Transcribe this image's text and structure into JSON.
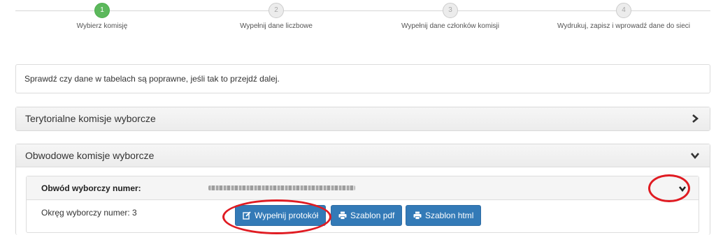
{
  "stepper": {
    "steps": [
      {
        "number": "1",
        "label": "Wybierz komisję",
        "active": true
      },
      {
        "number": "2",
        "label": "Wypełnij dane liczbowe",
        "active": false
      },
      {
        "number": "3",
        "label": "Wypełnij dane członków komisji",
        "active": false
      },
      {
        "number": "4",
        "label": "Wydrukuj, zapisz i wprowadź dane do sieci",
        "active": false
      }
    ]
  },
  "info": {
    "message": "Sprawdź czy dane w tabelach są poprawne, jeśli tak to przejdź dalej."
  },
  "panels": {
    "territorial": {
      "title": "Terytorialne komisje wyborcze",
      "icon": "chevron-right-icon"
    },
    "district": {
      "title": "Obwodowe komisje wyborcze",
      "icon": "chevron-down-icon"
    }
  },
  "district_item": {
    "label": "Obwód wyborczy numer:",
    "value_obscured": true,
    "okreg": "Okręg wyborczy numer: 3",
    "buttons": {
      "fill_protocol": "Wypełnij protokół",
      "pdf_template": "Szablon pdf",
      "html_template": "Szablon html"
    }
  },
  "colors": {
    "active_step": "#5cb85c",
    "primary_button": "#337ab7",
    "annotation": "#e01b22"
  }
}
